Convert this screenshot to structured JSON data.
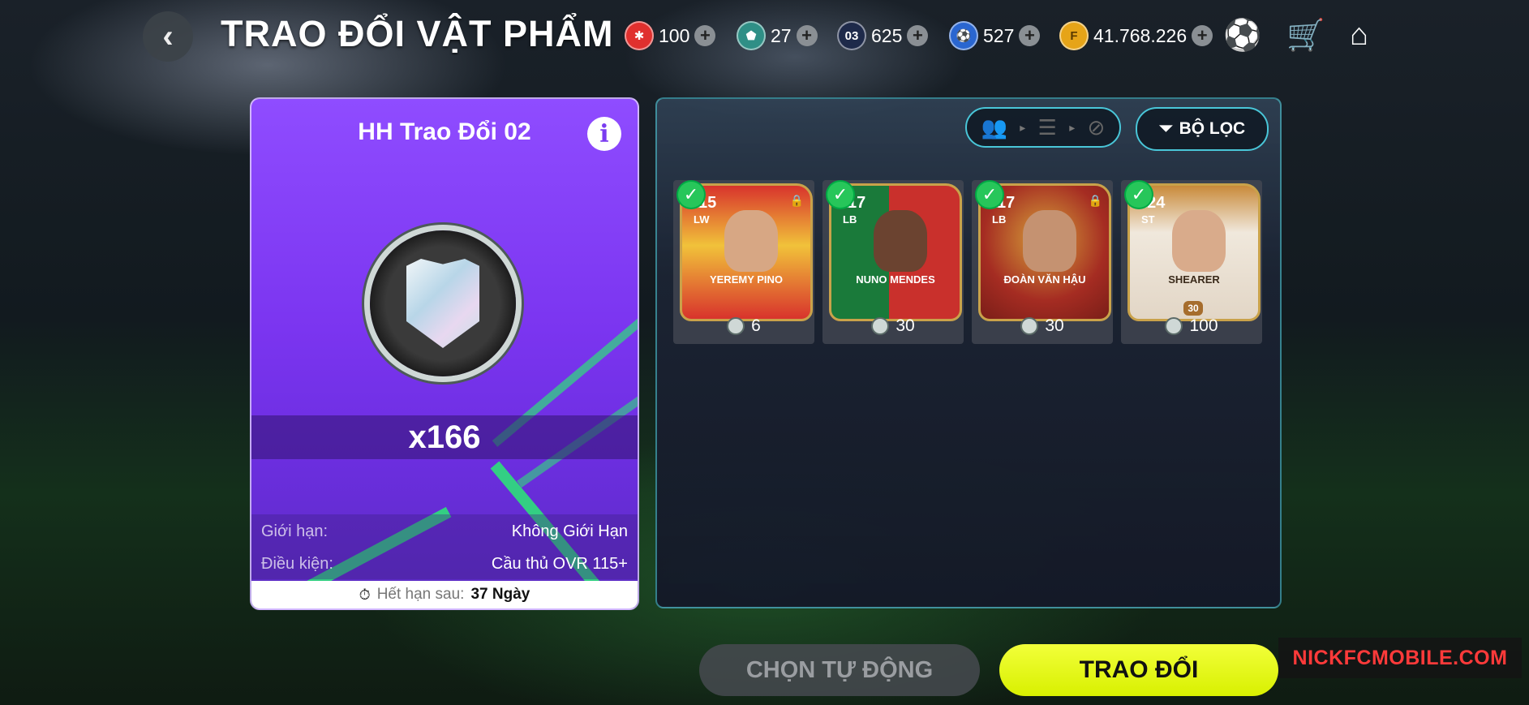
{
  "header": {
    "title": "TRAO ĐỔI VẬT PHẨM",
    "back_icon": "‹",
    "currencies": [
      {
        "icon": "puzzle-token-icon",
        "glyph": "✱",
        "color": "#e0302e",
        "amount": "100"
      },
      {
        "icon": "trade-token-icon",
        "glyph": "⬟",
        "color": "#2f8f86",
        "amount": "27"
      },
      {
        "icon": "card-pack-icon",
        "glyph": "03",
        "color": "#1e2a4a",
        "amount": "625"
      },
      {
        "icon": "player-token-icon",
        "glyph": "⚽",
        "color": "#2a66d0",
        "amount": "527"
      },
      {
        "icon": "fc-points-icon",
        "glyph": "F",
        "color": "#e6a418",
        "amount": "41.768.226"
      }
    ],
    "plus": "+"
  },
  "item_card": {
    "title": "HH Trao Đổi 02",
    "info": "i",
    "quantity": "x166",
    "limit_label": "Giới hạn:",
    "limit_value": "Không Giới Hạn",
    "condition_label": "Điều kiện:",
    "condition_value": "Cầu thủ OVR 115+",
    "expiry_label": "Hết hạn sau:",
    "expiry_value": "37 Ngày"
  },
  "filter": {
    "label": "BỘ LỌC"
  },
  "players": [
    {
      "ovr": "115",
      "pos": "LW",
      "name": "YEREMY PINO",
      "cost": "6",
      "bg": "#d8332c",
      "bg2": "#f1c23a",
      "face": "#d7a784",
      "lock": true
    },
    {
      "ovr": "117",
      "pos": "LB",
      "name": "NUNO MENDES",
      "cost": "30",
      "bg": "#1a7a3a",
      "bg2": "#c9302c",
      "face": "#6b4330",
      "lock": false
    },
    {
      "ovr": "117",
      "pos": "LB",
      "name": "ĐOÀN VĂN HẬU",
      "cost": "30",
      "bg": "#a52c22",
      "bg2": "#d7a33a",
      "face": "#c59271",
      "lock": true
    },
    {
      "ovr": "124",
      "pos": "ST",
      "name": "SHEARER",
      "cost": "100",
      "bg": "#e8e0d6",
      "bg2": "#c9a24a",
      "face": "#d9ab8b",
      "lock": false,
      "level": "30"
    }
  ],
  "buttons": {
    "auto": "CHỌN TỰ ĐỘNG",
    "trade": "TRAO ĐỔI"
  },
  "watermark": "NICKFCMOBILE.COM"
}
